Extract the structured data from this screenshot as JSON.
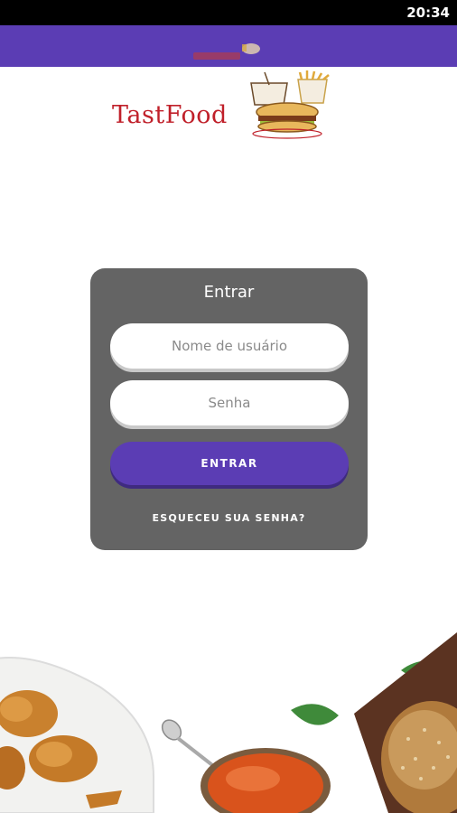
{
  "status_bar": {
    "time": "20:34"
  },
  "app_bar": {
    "logo_icon": "tastfood-small-logo-icon",
    "brand_color": "#5b3db4"
  },
  "brand": {
    "name": "TastFood",
    "logo_icon": "burger-drink-fries-icon",
    "text_color": "#c0202a"
  },
  "login": {
    "title": "Entrar",
    "username_placeholder": "Nome de usuário",
    "password_placeholder": "Senha",
    "submit_label": "ENTRAR",
    "forgot_label": "ESQUECEU SUA SENHA?",
    "card_color": "#646464"
  },
  "decor": {
    "icons": [
      "fried-chicken-plate-icon",
      "spoon-icon",
      "sauce-bowl-icon",
      "basil-leaf-icon",
      "bread-board-icon"
    ]
  }
}
